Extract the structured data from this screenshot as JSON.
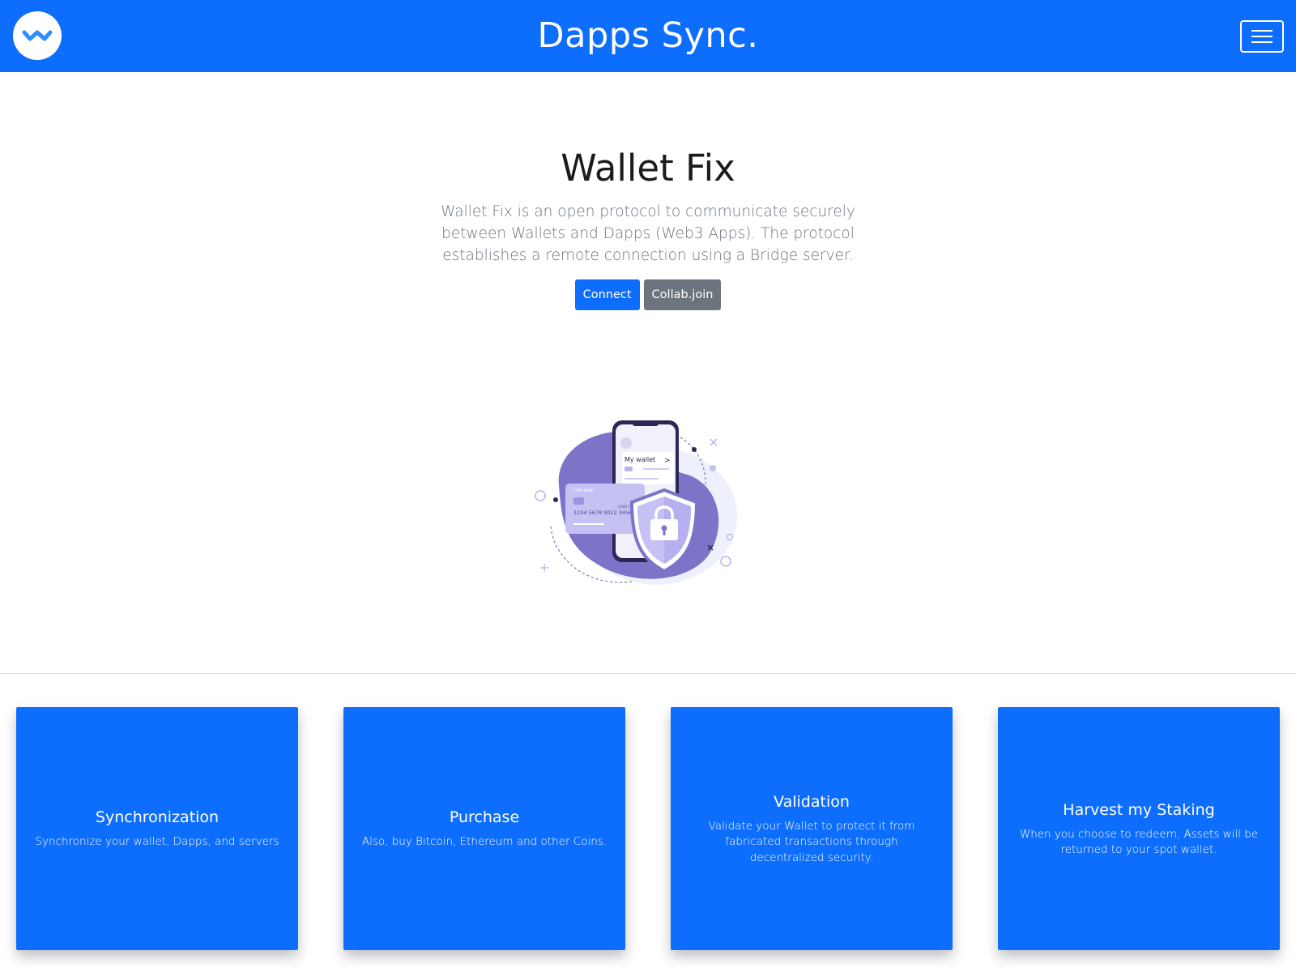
{
  "navbar": {
    "brand": "Dapps Sync.",
    "logo_icon": "walletconnect-logo-icon",
    "menu_icon": "hamburger-menu-icon",
    "color": "#0d6efd"
  },
  "hero": {
    "title": "Wallet Fix",
    "lead": "Wallet Fix is an open protocol to communicate securely between Wallets and Dapps (Web3 Apps). The protocol establishes a remote connection using a Bridge server.",
    "primary_button": "Connect",
    "secondary_button": "Collab.join",
    "illustration": {
      "phone_label": "My wallet",
      "card_number": "1234  5678  9012  3456",
      "card_type": "CARD TYPE"
    }
  },
  "features": [
    {
      "title": "Synchronization",
      "text": "Synchronize your wallet, Dapps, and servers"
    },
    {
      "title": "Purchase",
      "text": "Also, buy Bitcoin, Ethereum and other Coins."
    },
    {
      "title": "Validation",
      "text": "Validate your Wallet to protect it from fabricated transactions through decentralized security."
    },
    {
      "title": "Harvest my Staking",
      "text": "When you choose to redeem, Assets will be returned to your spot wallet."
    }
  ]
}
